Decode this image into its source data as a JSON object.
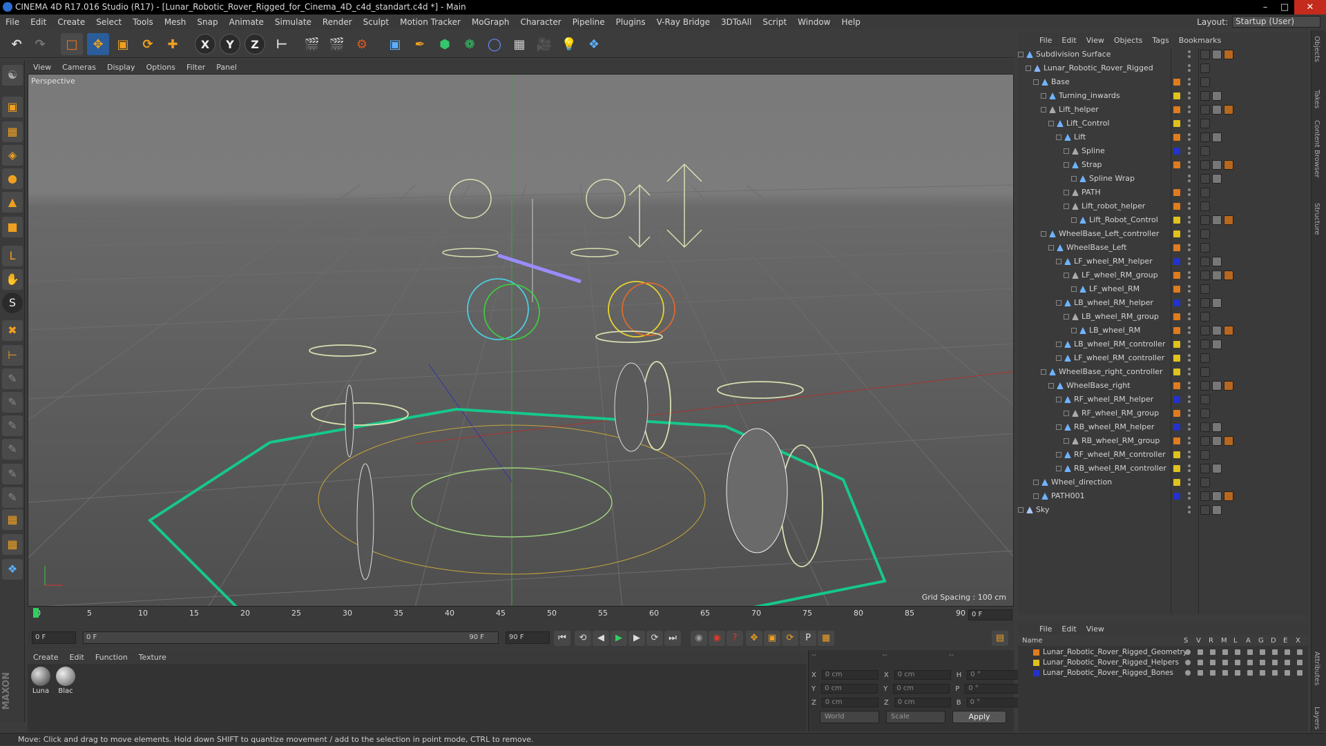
{
  "window": {
    "title": "CINEMA 4D R17.016 Studio (R17) - [Lunar_Robotic_Rover_Rigged_for_Cinema_4D_c4d_standart.c4d *] - Main"
  },
  "menu": [
    "File",
    "Edit",
    "Create",
    "Select",
    "Tools",
    "Mesh",
    "Snap",
    "Animate",
    "Simulate",
    "Render",
    "Sculpt",
    "Motion Tracker",
    "MoGraph",
    "Character",
    "Pipeline",
    "Plugins",
    "V-Ray Bridge",
    "3DToAll",
    "Script",
    "Window",
    "Help"
  ],
  "layout": {
    "label": "Layout:",
    "value": "Startup (User)"
  },
  "toolbar": {
    "axis_x": "X",
    "axis_y": "Y",
    "axis_z": "Z"
  },
  "viewport": {
    "menu": [
      "View",
      "Cameras",
      "Display",
      "Options",
      "Filter",
      "Panel"
    ],
    "label": "Perspective",
    "grid_spacing": "Grid Spacing : 100 cm"
  },
  "timeline": {
    "ticks": [
      "0",
      "5",
      "10",
      "15",
      "20",
      "25",
      "30",
      "35",
      "40",
      "45",
      "50",
      "55",
      "60",
      "65",
      "70",
      "75",
      "80",
      "85",
      "90"
    ],
    "current_frame": "0 F"
  },
  "transport": {
    "start_field": "0 F",
    "range_start": "0 F",
    "range_end": "90 F",
    "end_field": "90 F"
  },
  "materials": {
    "menu": [
      "Create",
      "Edit",
      "Function",
      "Texture"
    ],
    "items": [
      {
        "name": "Luna"
      },
      {
        "name": "Blac"
      }
    ]
  },
  "coords": {
    "rows": [
      {
        "a": "X",
        "av": "0 cm",
        "b": "X",
        "bv": "0 cm",
        "c": "H",
        "cv": "0 °"
      },
      {
        "a": "Y",
        "av": "0 cm",
        "b": "Y",
        "bv": "0 cm",
        "c": "P",
        "cv": "0 °"
      },
      {
        "a": "Z",
        "av": "0 cm",
        "b": "Z",
        "bv": "0 cm",
        "c": "B",
        "cv": "0 °"
      }
    ],
    "mode": "World",
    "scale": "Scale",
    "apply": "Apply"
  },
  "object_manager": {
    "menu": [
      "File",
      "Edit",
      "View",
      "Objects",
      "Tags",
      "Bookmarks"
    ],
    "objects": [
      {
        "name": "Subdivision Surface",
        "depth": 0,
        "layer": "",
        "icon": "#6fb3ff"
      },
      {
        "name": "Lunar_Robotic_Rover_Rigged",
        "depth": 1,
        "layer": "",
        "icon": "#8ab4ff"
      },
      {
        "name": "Base",
        "depth": 2,
        "layer": "#e07b1e",
        "icon": "#6fb3ff"
      },
      {
        "name": "Turning_inwards",
        "depth": 3,
        "layer": "#e0c21e",
        "icon": "#6fb3ff"
      },
      {
        "name": "Lift_helper",
        "depth": 3,
        "layer": "#e07b1e",
        "icon": "#aaa"
      },
      {
        "name": "Lift_Control",
        "depth": 4,
        "layer": "#e0c21e",
        "icon": "#6fb3ff"
      },
      {
        "name": "Lift",
        "depth": 5,
        "layer": "#e07b1e",
        "icon": "#6fb3ff"
      },
      {
        "name": "Spline",
        "depth": 6,
        "layer": "#2233cc",
        "icon": "#aaa"
      },
      {
        "name": "Strap",
        "depth": 6,
        "layer": "#e07b1e",
        "icon": "#6fb3ff"
      },
      {
        "name": "Spline Wrap",
        "depth": 7,
        "layer": "",
        "icon": "#6fb3ff"
      },
      {
        "name": "PATH",
        "depth": 6,
        "layer": "#e07b1e",
        "icon": "#aaa"
      },
      {
        "name": "Lift_robot_helper",
        "depth": 6,
        "layer": "#e07b1e",
        "icon": "#aaa"
      },
      {
        "name": "Lift_Robot_Control",
        "depth": 7,
        "layer": "#e0c21e",
        "icon": "#6fb3ff"
      },
      {
        "name": "WheelBase_Left_controller",
        "depth": 3,
        "layer": "#e0c21e",
        "icon": "#6fb3ff"
      },
      {
        "name": "WheelBase_Left",
        "depth": 4,
        "layer": "#e07b1e",
        "icon": "#6fb3ff"
      },
      {
        "name": "LF_wheel_RM_helper",
        "depth": 5,
        "layer": "#2233cc",
        "icon": "#6fb3ff"
      },
      {
        "name": "LF_wheel_RM_group",
        "depth": 6,
        "layer": "#e07b1e",
        "icon": "#aaa"
      },
      {
        "name": "LF_wheel_RM",
        "depth": 7,
        "layer": "#e07b1e",
        "icon": "#6fb3ff"
      },
      {
        "name": "LB_wheel_RM_helper",
        "depth": 5,
        "layer": "#2233cc",
        "icon": "#6fb3ff"
      },
      {
        "name": "LB_wheel_RM_group",
        "depth": 6,
        "layer": "#e07b1e",
        "icon": "#aaa"
      },
      {
        "name": "LB_wheel_RM",
        "depth": 7,
        "layer": "#e07b1e",
        "icon": "#6fb3ff"
      },
      {
        "name": "LB_wheel_RM_controller",
        "depth": 5,
        "layer": "#e0c21e",
        "icon": "#6fb3ff"
      },
      {
        "name": "LF_wheel_RM_controller",
        "depth": 5,
        "layer": "#e0c21e",
        "icon": "#6fb3ff"
      },
      {
        "name": "WheelBase_right_controller",
        "depth": 3,
        "layer": "#e0c21e",
        "icon": "#6fb3ff"
      },
      {
        "name": "WheelBase_right",
        "depth": 4,
        "layer": "#e07b1e",
        "icon": "#6fb3ff"
      },
      {
        "name": "RF_wheel_RM_helper",
        "depth": 5,
        "layer": "#2233cc",
        "icon": "#6fb3ff"
      },
      {
        "name": "RF_wheel_RM_group",
        "depth": 6,
        "layer": "#e07b1e",
        "icon": "#aaa"
      },
      {
        "name": "RB_wheel_RM_helper",
        "depth": 5,
        "layer": "#2233cc",
        "icon": "#6fb3ff"
      },
      {
        "name": "RB_wheel_RM_group",
        "depth": 6,
        "layer": "#e07b1e",
        "icon": "#aaa"
      },
      {
        "name": "RF_wheel_RM_controller",
        "depth": 5,
        "layer": "#e0c21e",
        "icon": "#6fb3ff"
      },
      {
        "name": "RB_wheel_RM_controller",
        "depth": 5,
        "layer": "#e0c21e",
        "icon": "#6fb3ff"
      },
      {
        "name": "Wheel_direction",
        "depth": 2,
        "layer": "#e0c21e",
        "icon": "#6fb3ff"
      },
      {
        "name": "PATH001",
        "depth": 2,
        "layer": "#2233cc",
        "icon": "#6fb3ff"
      },
      {
        "name": "Sky",
        "depth": 0,
        "layer": "",
        "icon": "#aac8ff"
      }
    ]
  },
  "layer_manager": {
    "menu": [
      "File",
      "Edit",
      "View"
    ],
    "columns": [
      "Name",
      "S",
      "V",
      "R",
      "M",
      "L",
      "A",
      "G",
      "D",
      "E",
      "X"
    ],
    "layers": [
      {
        "name": "Lunar_Robotic_Rover_Rigged_Geometry",
        "color": "#e07b1e"
      },
      {
        "name": "Lunar_Robotic_Rover_Rigged_Helpers",
        "color": "#e0c21e"
      },
      {
        "name": "Lunar_Robotic_Rover_Rigged_Bones",
        "color": "#2233cc"
      }
    ]
  },
  "right_tabs": [
    "Objects",
    "Takes",
    "Content Browser",
    "Structure",
    "Attributes",
    "Layers"
  ],
  "status": "Move: Click and drag to move elements. Hold down SHIFT to quantize movement / add to the selection in point mode, CTRL to remove."
}
